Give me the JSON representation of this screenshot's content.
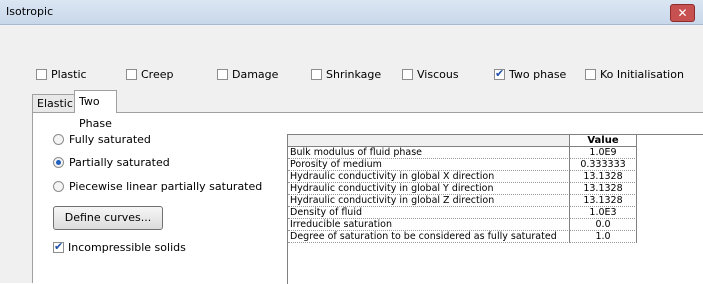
{
  "window": {
    "title": "Isotropic",
    "close_icon": "close-icon"
  },
  "flags": [
    {
      "label": "Plastic",
      "checked": false
    },
    {
      "label": "Creep",
      "checked": false
    },
    {
      "label": "Damage",
      "checked": false
    },
    {
      "label": "Shrinkage",
      "checked": false
    },
    {
      "label": "Viscous",
      "checked": false
    },
    {
      "label": "Two phase",
      "checked": true
    },
    {
      "label": "Ko Initialisation",
      "checked": false
    }
  ],
  "tabs": [
    {
      "label": "Elastic",
      "active": false
    },
    {
      "label": "Two Phase",
      "active": true
    }
  ],
  "saturation_options": [
    {
      "label": "Fully saturated",
      "selected": false
    },
    {
      "label": "Partially saturated",
      "selected": true
    },
    {
      "label": "Piecewise linear partially saturated",
      "selected": false
    }
  ],
  "define_curves_label": "Define curves...",
  "incompressible": {
    "label": "Incompressible solids",
    "checked": true
  },
  "table": {
    "header": "Value",
    "rows": [
      {
        "name": "Bulk modulus of fluid phase",
        "value": "1.0E9"
      },
      {
        "name": "Porosity of medium",
        "value": "0.333333"
      },
      {
        "name": "Hydraulic conductivity in global X direction",
        "value": "13.1328"
      },
      {
        "name": "Hydraulic conductivity in global Y direction",
        "value": "13.1328"
      },
      {
        "name": "Hydraulic conductivity in global Z direction",
        "value": "13.1328"
      },
      {
        "name": "Density of fluid",
        "value": "1.0E3"
      },
      {
        "name": "Irreducible saturation",
        "value": "0.0"
      },
      {
        "name": "Degree of saturation to be considered as fully saturated",
        "value": "1.0"
      }
    ]
  }
}
